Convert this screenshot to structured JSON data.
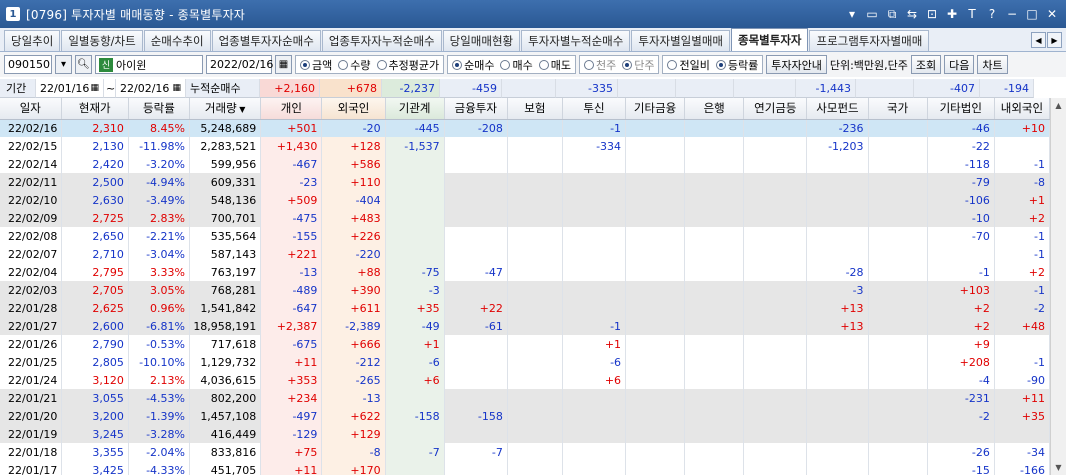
{
  "window": {
    "number": "1",
    "title": "[0796] 투자자별 매매동향 - 종목별투자자"
  },
  "titlebar_icons": [
    "menu-down-icon",
    "screen-icon",
    "new-window-icon",
    "link-icon",
    "lock-icon",
    "pin-icon",
    "font-icon",
    "help-icon",
    "minimize-icon",
    "maximize-icon",
    "close-icon"
  ],
  "tabs": [
    "당일추이",
    "일별동향/차트",
    "순매수추이",
    "업종별투자자순매수",
    "업종투자자누적순매수",
    "당일매매현황",
    "투자자별누적순매수",
    "투자자별일별매매",
    "종목별투자자",
    "프로그램투자자별매매"
  ],
  "active_tab": 8,
  "controls": {
    "code": "090150",
    "badge": "신",
    "name": "아이윈",
    "date": "2022/02/16",
    "amount_radio": [
      "금액",
      "수량",
      "추정평균가"
    ],
    "amount_selected": 0,
    "trade_radio": [
      "순매수",
      "매수",
      "매도"
    ],
    "trade_selected": 0,
    "period_radio": [
      "천주",
      "단주"
    ],
    "compare_radio": [
      "전일비",
      "등락률"
    ],
    "compare_selected": 1,
    "investor_button": "투자자안내",
    "unit": "단위:백만원,단주",
    "btn_query": "조회",
    "btn_next": "다음",
    "btn_chart": "차트"
  },
  "summary": {
    "period_label": "기간",
    "from": "22/01/16",
    "sep": "~",
    "to": "22/02/16",
    "cum_label": "누적순매수",
    "values": [
      "+2,160",
      "+678",
      "-2,237",
      "-459",
      "",
      "-335",
      "",
      "",
      "",
      "-1,443",
      "",
      "-407",
      "-194"
    ]
  },
  "columns": [
    "일자",
    "현재가",
    "등락률",
    "거래량",
    "개인",
    "외국인",
    "기관계",
    "금융투자",
    "보험",
    "투신",
    "기타금융",
    "은행",
    "연기금등",
    "사모펀드",
    "국가",
    "기타법인",
    "내외국인"
  ],
  "rows": [
    {
      "c": [
        "22/02/16",
        "2,310",
        "8.45%",
        "5,248,689",
        "+501",
        "-20",
        "-445",
        "-208",
        "",
        "-1",
        "",
        "",
        "",
        "-236",
        "",
        "-46",
        "+10"
      ],
      "dir": "up",
      "sel": true,
      "gr": false
    },
    {
      "c": [
        "22/02/15",
        "2,130",
        "-11.98%",
        "2,283,521",
        "+1,430",
        "+128",
        "-1,537",
        "",
        "",
        "-334",
        "",
        "",
        "",
        "-1,203",
        "",
        "-22",
        ""
      ],
      "dir": "down",
      "sel": false,
      "gr": false
    },
    {
      "c": [
        "22/02/14",
        "2,420",
        "-3.20%",
        "599,956",
        "-467",
        "+586",
        "",
        "",
        "",
        "",
        "",
        "",
        "",
        "",
        "",
        "-118",
        "-1"
      ],
      "dir": "down",
      "sel": false,
      "gr": false
    },
    {
      "c": [
        "22/02/11",
        "2,500",
        "-4.94%",
        "609,331",
        "-23",
        "+110",
        "",
        "",
        "",
        "",
        "",
        "",
        "",
        "",
        "",
        "-79",
        "-8"
      ],
      "dir": "down",
      "sel": false,
      "gr": true
    },
    {
      "c": [
        "22/02/10",
        "2,630",
        "-3.49%",
        "548,136",
        "+509",
        "-404",
        "",
        "",
        "",
        "",
        "",
        "",
        "",
        "",
        "",
        "-106",
        "+1"
      ],
      "dir": "down",
      "sel": false,
      "gr": true
    },
    {
      "c": [
        "22/02/09",
        "2,725",
        "2.83%",
        "700,701",
        "-475",
        "+483",
        "",
        "",
        "",
        "",
        "",
        "",
        "",
        "",
        "",
        "-10",
        "+2"
      ],
      "dir": "up",
      "sel": false,
      "gr": true
    },
    {
      "c": [
        "22/02/08",
        "2,650",
        "-2.21%",
        "535,564",
        "-155",
        "+226",
        "",
        "",
        "",
        "",
        "",
        "",
        "",
        "",
        "",
        "-70",
        "-1"
      ],
      "dir": "down",
      "sel": false,
      "gr": false
    },
    {
      "c": [
        "22/02/07",
        "2,710",
        "-3.04%",
        "587,143",
        "+221",
        "-220",
        "",
        "",
        "",
        "",
        "",
        "",
        "",
        "",
        "",
        "",
        "-1"
      ],
      "dir": "down",
      "sel": false,
      "gr": false
    },
    {
      "c": [
        "22/02/04",
        "2,795",
        "3.33%",
        "763,197",
        "-13",
        "+88",
        "-75",
        "-47",
        "",
        "",
        "",
        "",
        "",
        "-28",
        "",
        "-1",
        "+2"
      ],
      "dir": "up",
      "sel": false,
      "gr": false
    },
    {
      "c": [
        "22/02/03",
        "2,705",
        "3.05%",
        "768,281",
        "-489",
        "+390",
        "-3",
        "",
        "",
        "",
        "",
        "",
        "",
        "-3",
        "",
        "+103",
        "-1"
      ],
      "dir": "up",
      "sel": false,
      "gr": true
    },
    {
      "c": [
        "22/01/28",
        "2,625",
        "0.96%",
        "1,541,842",
        "-647",
        "+611",
        "+35",
        "+22",
        "",
        "",
        "",
        "",
        "",
        "+13",
        "",
        "+2",
        "-2"
      ],
      "dir": "up",
      "sel": false,
      "gr": true
    },
    {
      "c": [
        "22/01/27",
        "2,600",
        "-6.81%",
        "18,958,191",
        "+2,387",
        "-2,389",
        "-49",
        "-61",
        "",
        "-1",
        "",
        "",
        "",
        "+13",
        "",
        "+2",
        "+48"
      ],
      "dir": "down",
      "sel": false,
      "gr": true
    },
    {
      "c": [
        "22/01/26",
        "2,790",
        "-0.53%",
        "717,618",
        "-675",
        "+666",
        "+1",
        "",
        "",
        "+1",
        "",
        "",
        "",
        "",
        "",
        "+9",
        ""
      ],
      "dir": "down",
      "sel": false,
      "gr": false
    },
    {
      "c": [
        "22/01/25",
        "2,805",
        "-10.10%",
        "1,129,732",
        "+11",
        "-212",
        "-6",
        "",
        "",
        "-6",
        "",
        "",
        "",
        "",
        "",
        "+208",
        "-1"
      ],
      "dir": "down",
      "sel": false,
      "gr": false
    },
    {
      "c": [
        "22/01/24",
        "3,120",
        "2.13%",
        "4,036,615",
        "+353",
        "-265",
        "+6",
        "",
        "",
        "+6",
        "",
        "",
        "",
        "",
        "",
        "-4",
        "-90"
      ],
      "dir": "up",
      "sel": false,
      "gr": false
    },
    {
      "c": [
        "22/01/21",
        "3,055",
        "-4.53%",
        "802,200",
        "+234",
        "-13",
        "",
        "",
        "",
        "",
        "",
        "",
        "",
        "",
        "",
        "-231",
        "+11"
      ],
      "dir": "down",
      "sel": false,
      "gr": true
    },
    {
      "c": [
        "22/01/20",
        "3,200",
        "-1.39%",
        "1,457,108",
        "-497",
        "+622",
        "-158",
        "-158",
        "",
        "",
        "",
        "",
        "",
        "",
        "",
        "-2",
        "+35"
      ],
      "dir": "down",
      "sel": false,
      "gr": true
    },
    {
      "c": [
        "22/01/19",
        "3,245",
        "-3.28%",
        "416,449",
        "-129",
        "+129",
        "",
        "",
        "",
        "",
        "",
        "",
        "",
        "",
        "",
        "",
        ""
      ],
      "dir": "down",
      "sel": false,
      "gr": true
    },
    {
      "c": [
        "22/01/18",
        "3,355",
        "-2.04%",
        "833,816",
        "+75",
        "-8",
        "-7",
        "-7",
        "",
        "",
        "",
        "",
        "",
        "",
        "",
        "-26",
        "-34"
      ],
      "dir": "down",
      "sel": false,
      "gr": false
    },
    {
      "c": [
        "22/01/17",
        "3,425",
        "-4.33%",
        "451,705",
        "+11",
        "+170",
        "",
        "",
        "",
        "",
        "",
        "",
        "",
        "",
        "",
        "-15",
        "-166"
      ],
      "dir": "down",
      "sel": false,
      "gr": false
    }
  ]
}
